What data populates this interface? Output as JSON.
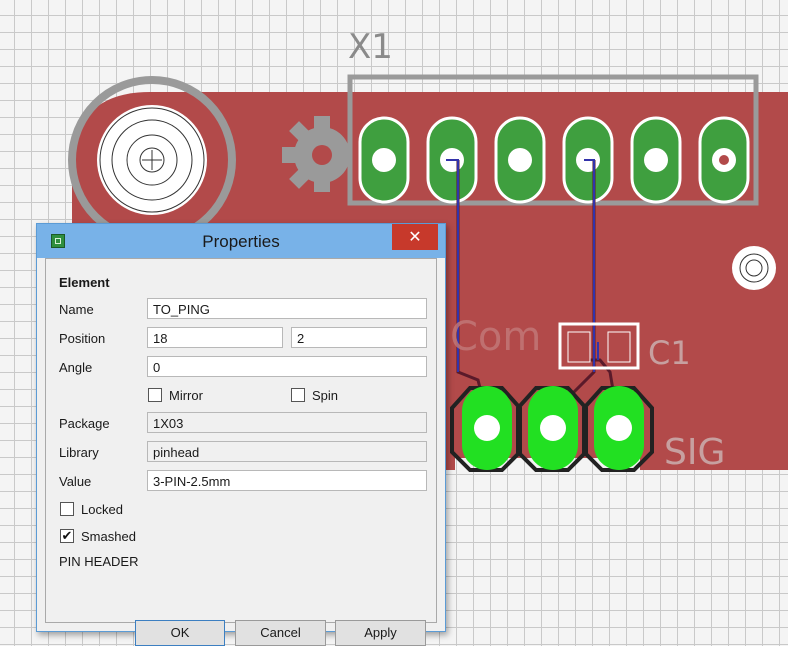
{
  "board": {
    "part_name": "X1",
    "cap_name": "C1",
    "sig_label": "SIG",
    "silk_text": "Com",
    "colors": {
      "board_red": "#b24a4a",
      "pad_green": "#3f9f3f",
      "pad_bright_green": "#22e022",
      "silkscreen_gray": "#9a9a9a",
      "trace_dark": "#5a1a2a"
    }
  },
  "dialog": {
    "title": "Properties",
    "close_glyph": "✕",
    "section": "Element",
    "labels": {
      "name": "Name",
      "position": "Position",
      "angle": "Angle",
      "package": "Package",
      "library": "Library",
      "value": "Value"
    },
    "name_value": "TO_PING",
    "position_x": "18",
    "position_y": "2",
    "angle_value": "0",
    "mirror_label": "Mirror",
    "spin_label": "Spin",
    "package_value": "1X03",
    "library_value": "pinhead",
    "value_value": "3-PIN-2.5mm",
    "locked_label": "Locked",
    "smashed_label": "Smashed",
    "mirror_checked": false,
    "spin_checked": false,
    "locked_checked": false,
    "smashed_checked": true,
    "check_glyph": "✔",
    "description": "PIN HEADER",
    "buttons": {
      "ok": "OK",
      "cancel": "Cancel",
      "apply": "Apply"
    }
  },
  "icons": {
    "app": "eagle-app-icon",
    "close": "close-icon",
    "check": "checkmark-icon"
  }
}
